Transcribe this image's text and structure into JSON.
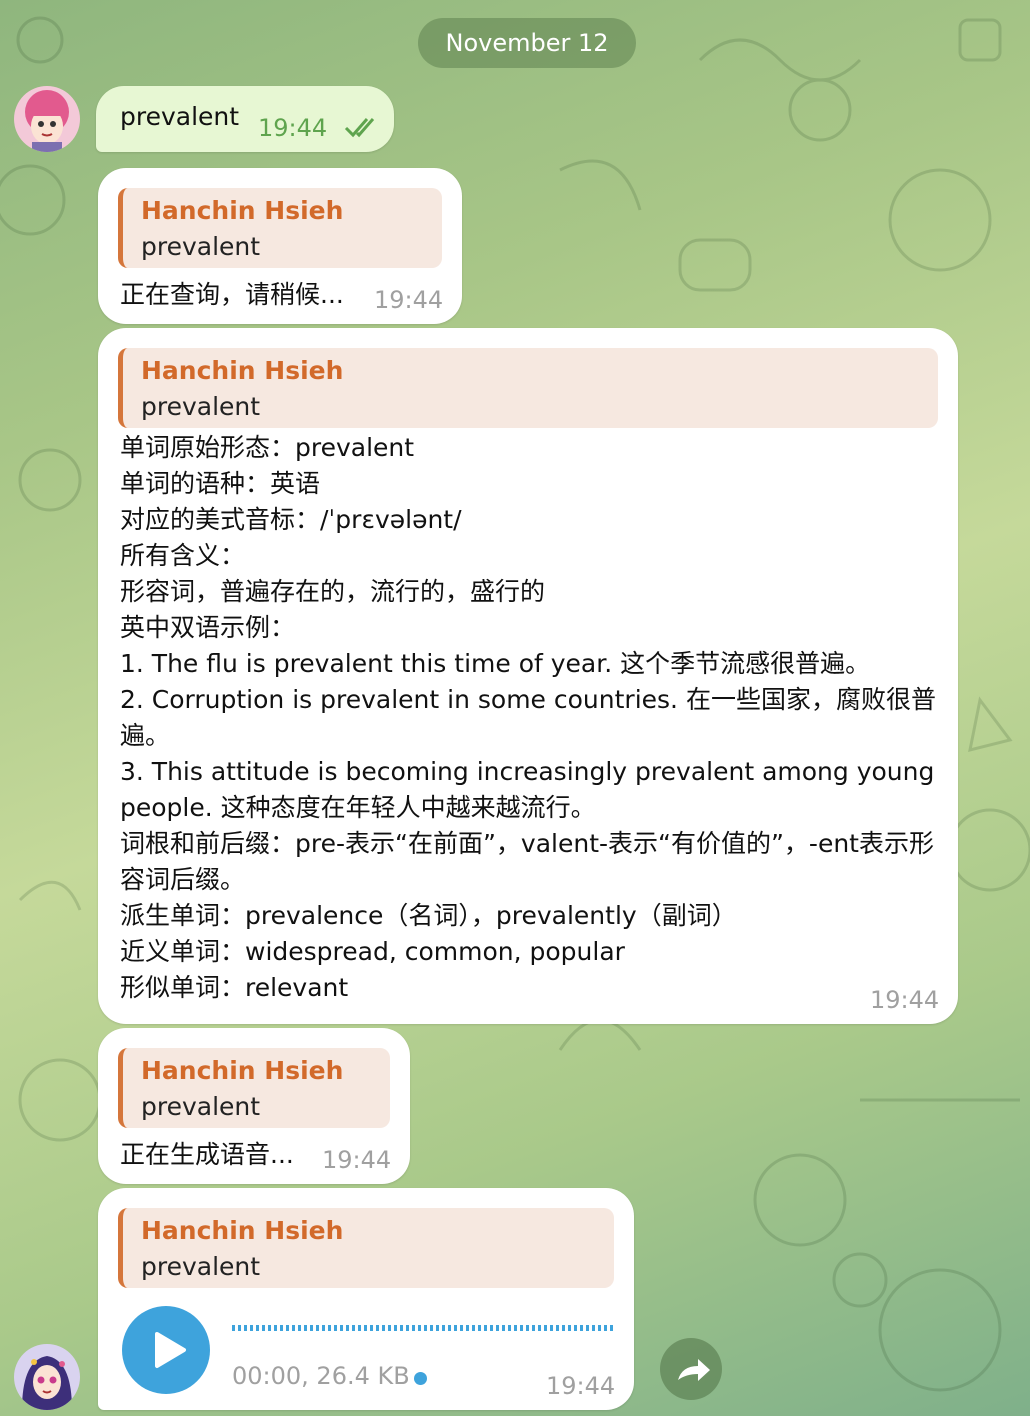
{
  "date_label": "November 12",
  "messages": {
    "out1": {
      "text": "prevalent",
      "time": "19:44"
    },
    "reply1": {
      "quote_name": "Hanchin Hsieh",
      "quote_text": "prevalent",
      "text": "正在查询，请稍候...",
      "time": "19:44"
    },
    "reply2": {
      "quote_name": "Hanchin Hsieh",
      "quote_text": "prevalent",
      "lines": [
        "单词原始形态：prevalent",
        "单词的语种：英语",
        "对应的美式音标：/ˈprɛvələnt/",
        "所有含义：",
        "形容词，普遍存在的，流行的，盛行的",
        "英中双语示例：",
        "1. The flu is prevalent this time of year. 这个季节流感很普遍。",
        "2. Corruption is prevalent in some countries. 在一些国家，腐败很普",
        "遍。",
        "3. This attitude is becoming increasingly prevalent among young",
        "people. 这种态度在年轻人中越来越流行。",
        "词根和前后缀：pre-表示“在前面”，valent-表示“有价值的”，-ent表示形",
        "容词后缀。",
        "派生单词：prevalence（名词），prevalently（副词）",
        "近义单词：widespread, common, popular",
        "形似单词：relevant"
      ],
      "time": "19:44"
    },
    "reply3": {
      "quote_name": "Hanchin Hsieh",
      "quote_text": "prevalent",
      "text": "正在生成语音...",
      "time": "19:44"
    },
    "reply4": {
      "quote_name": "Hanchin Hsieh",
      "quote_text": "prevalent",
      "voice_meta": "00:00, 26.4 KB",
      "time": "19:44"
    }
  },
  "icons": [
    "double-check-icon",
    "play-icon",
    "share-icon"
  ],
  "colors": {
    "accent": "#3ea3dc",
    "quote_name": "#d2692a",
    "quote_bar": "#d5763b",
    "out_bubble": "#e7f7d3"
  }
}
